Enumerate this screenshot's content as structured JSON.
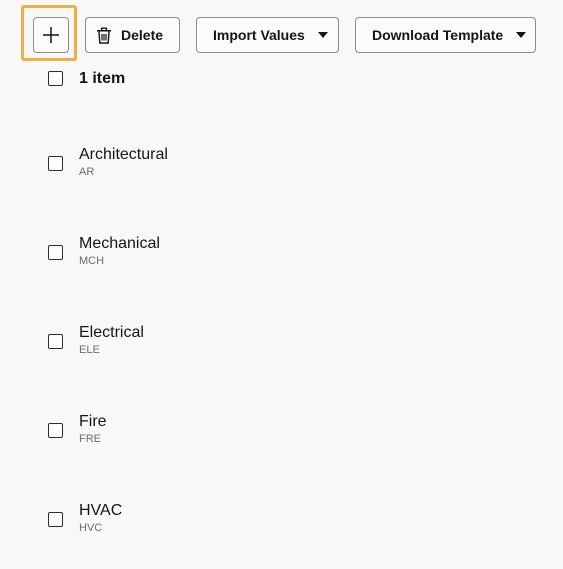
{
  "toolbar": {
    "add_icon": "plus-icon",
    "delete_label": "Delete",
    "delete_icon": "trash-icon",
    "import_label": "Import Values",
    "download_label": "Download Template"
  },
  "list_header": {
    "count_label": "1 item"
  },
  "items": [
    {
      "name": "Architectural",
      "code": "AR"
    },
    {
      "name": "Mechanical",
      "code": "MCH"
    },
    {
      "name": "Electrical",
      "code": "ELE"
    },
    {
      "name": "Fire",
      "code": "FRE"
    },
    {
      "name": "HVAC",
      "code": "HVC"
    }
  ],
  "colors": {
    "focus_ring": "#e9b04a",
    "background": "#f9f8f6"
  }
}
